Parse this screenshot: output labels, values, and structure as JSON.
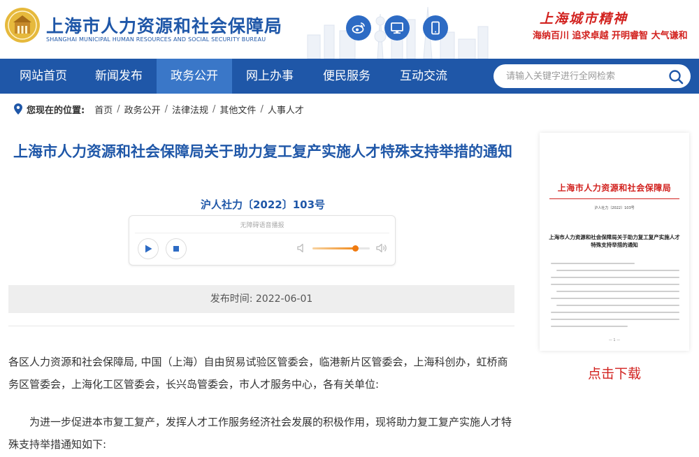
{
  "header": {
    "title": "上海市人力资源和社会保障局",
    "subtitle": "SHANGHAI MUNICIPAL HUMAN RESOURCES AND SOCIAL SECURITY BUREAU",
    "spirit_title": "上海城市精神",
    "spirit_motto": "海纳百川  追求卓越  开明睿智  大气谦和",
    "social_icons": [
      "weibo-icon",
      "desktop-icon",
      "mobile-icon"
    ]
  },
  "nav": {
    "items": [
      "网站首页",
      "新闻发布",
      "政务公开",
      "网上办事",
      "便民服务",
      "互动交流"
    ],
    "active_index": 2
  },
  "search": {
    "placeholder": "请输入关键字进行全网检索"
  },
  "breadcrumb": {
    "label": "您现在的位置:",
    "items": [
      "首页",
      "政务公开",
      "法律法规",
      "其他文件",
      "人事人才"
    ]
  },
  "article": {
    "title": "上海市人力资源和社会保障局关于助力复工复产实施人才特殊支持举措的通知",
    "doc_number": "沪人社力〔2022〕103号",
    "audio_label": "无障碍语音播报",
    "publish_time": "发布时间: 2022-06-01",
    "paragraphs": [
      "各区人力资源和社会保障局, 中国（上海）自由贸易试验区管委会，临港新片区管委会，上海科创办，虹桥商务区管委会，上海化工区管委会，长兴岛管委会，市人才服务中心，各有关单位:",
      "为进一步促进本市复工复产，发挥人才工作服务经济社会发展的积极作用，现将助力复工复产实施人才特殊支持举措通知如下:"
    ]
  },
  "audio": {
    "volume": 0.75
  },
  "preview": {
    "header": "上海市人力资源和社会保障局",
    "doc_number": "沪人社力〔2022〕103号",
    "title": "上海市人力资源和社会保障局关于助力复工复产实施人才特殊支持举措的通知",
    "page": "— 1 —",
    "download_label": "点击下载"
  },
  "colors": {
    "brand_blue": "#1f57a8",
    "nav_active": "#3a77c8",
    "accent_red": "#d2221f",
    "volume_orange": "#f07a10"
  }
}
